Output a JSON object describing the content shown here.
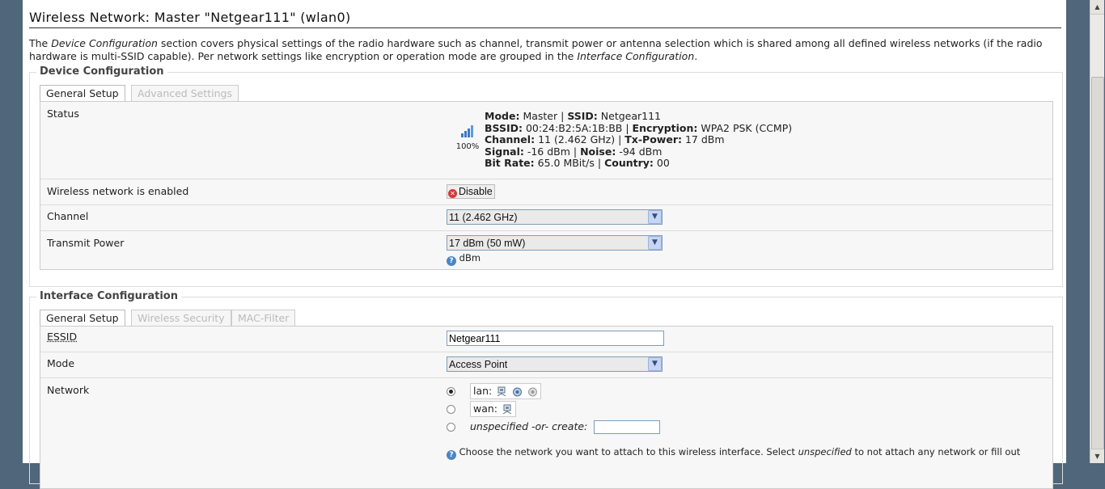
{
  "title": "Wireless Network: Master \"Netgear111\" (wlan0)",
  "description": {
    "p1": "The ",
    "em1": "Device Configuration",
    "p2": " section covers physical settings of the radio hardware such as channel, transmit power or antenna selection which is shared among all defined wireless networks (if the radio hardware is multi-SSID capable). Per network settings like encryption or operation mode are grouped in the ",
    "em2": "Interface Configuration",
    "p3": "."
  },
  "device_config": {
    "legend": "Device Configuration",
    "tabs": [
      {
        "label": "General Setup",
        "active": true
      },
      {
        "label": "Advanced Settings",
        "active": false
      }
    ],
    "status": {
      "label": "Status",
      "signal_percent": "100%",
      "mode_k": "Mode:",
      "mode_v": "Master",
      "ssid_k": "SSID:",
      "ssid_v": "Netgear111",
      "bssid_k": "BSSID:",
      "bssid_v": "00:24:B2:5A:1B:BB",
      "enc_k": "Encryption:",
      "enc_v": "WPA2 PSK (CCMP)",
      "channel_k": "Channel:",
      "channel_v": "11 (2.462 GHz)",
      "txpower_k": "Tx-Power:",
      "txpower_v": "17 dBm",
      "signal_k": "Signal:",
      "signal_v": "-16 dBm",
      "noise_k": "Noise:",
      "noise_v": "-94 dBm",
      "bitrate_k": "Bit Rate:",
      "bitrate_v": "65.0 MBit/s",
      "country_k": "Country:",
      "country_v": "00",
      "sep": " | "
    },
    "enabled": {
      "label": "Wireless network is enabled",
      "button": "Disable"
    },
    "channel": {
      "label": "Channel",
      "value": "11 (2.462 GHz)"
    },
    "txpower": {
      "label": "Transmit Power",
      "value": "17 dBm (50 mW)",
      "hint": "dBm"
    }
  },
  "iface_config": {
    "legend": "Interface Configuration",
    "tabs": [
      {
        "label": "General Setup",
        "active": true
      },
      {
        "label": "Wireless Security",
        "active": false
      },
      {
        "label": "MAC-Filter",
        "active": false
      }
    ],
    "essid": {
      "label": "ESSID",
      "value": "Netgear111"
    },
    "mode": {
      "label": "Mode",
      "value": "Access Point"
    },
    "network": {
      "label": "Network",
      "options": [
        {
          "label": "lan:",
          "checked": true
        },
        {
          "label": "wan:",
          "checked": false
        },
        {
          "label": "unspecified -or- create:",
          "checked": false
        }
      ],
      "create_value": "",
      "hint_a": "Choose the network you want to attach to this wireless interface. Select ",
      "hint_em": "unspecified",
      "hint_b": " to not attach any network or fill out"
    }
  },
  "colors": {
    "background": "#50667a",
    "panel": "#f7f7f7",
    "signal": "#3b78c8"
  }
}
